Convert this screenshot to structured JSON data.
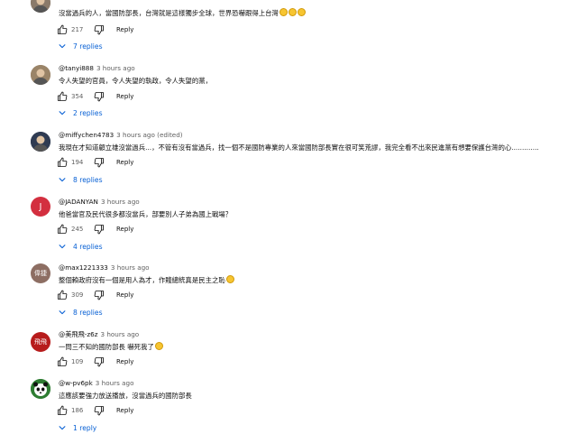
{
  "reply_label": "Reply",
  "comments": [
    {
      "author": "",
      "time": "",
      "text": "沒當過兵的人，當國防部長，台灣就是這樣獨步全球，世界恐嚇跟得上台灣",
      "emoji_count": 3,
      "likes": "217",
      "replies": "7 replies",
      "avatar": {
        "type": "photo",
        "color": "#8a7a6a"
      }
    },
    {
      "author": "@tanyi888",
      "time": "3 hours ago",
      "text": "令人失望的官員，令人失望的執政，令人失望的黨，",
      "emoji_count": 0,
      "likes": "354",
      "replies": "2 replies",
      "avatar": {
        "type": "photo",
        "color": "#9a8468"
      }
    },
    {
      "author": "@miffychen4783",
      "time": "3 hours ago (edited)",
      "text": "我現在才知道顧立雄沒當過兵...，不管有沒有當過兵，找一個不是國防專業的人來當國防部長實在很可笑荒謬，我完全看不出來民進黨有想要保護台灣的心.............",
      "emoji_count": 0,
      "likes": "194",
      "replies": "8 replies",
      "avatar": {
        "type": "photo",
        "color": "#2f3b52"
      }
    },
    {
      "author": "@JADANYAN",
      "time": "3 hours ago",
      "text": "他爸當官及民代很多都沒當兵，部要別人子弟為國上戰場？",
      "emoji_count": 0,
      "likes": "245",
      "replies": "4 replies",
      "avatar": {
        "type": "letter",
        "letter": "J",
        "color": "#d32f3f"
      }
    },
    {
      "author": "@max1221333",
      "time": "3 hours ago",
      "text": "整個賴政府沒有一個是用人為才，作賤總統真是民主之恥",
      "emoji_count": 1,
      "likes": "309",
      "replies": "8 replies",
      "avatar": {
        "type": "letter",
        "letter": "偉捷",
        "color": "#8d6e63"
      }
    },
    {
      "author": "@美飛飛-z6z",
      "time": "3 hours ago",
      "text": "一問三不知的國防部長 嚇死我了",
      "emoji_count": 1,
      "likes": "109",
      "replies": "",
      "avatar": {
        "type": "letter",
        "letter": "飛飛",
        "color": "#b71c1c"
      }
    },
    {
      "author": "@w-pv6pk",
      "time": "3 hours ago",
      "text": "這應該要強力放送播放，沒當過兵的國防部長",
      "emoji_count": 0,
      "likes": "186",
      "replies": "1 reply",
      "avatar": {
        "type": "panda",
        "color": "#2e7d32"
      }
    }
  ]
}
